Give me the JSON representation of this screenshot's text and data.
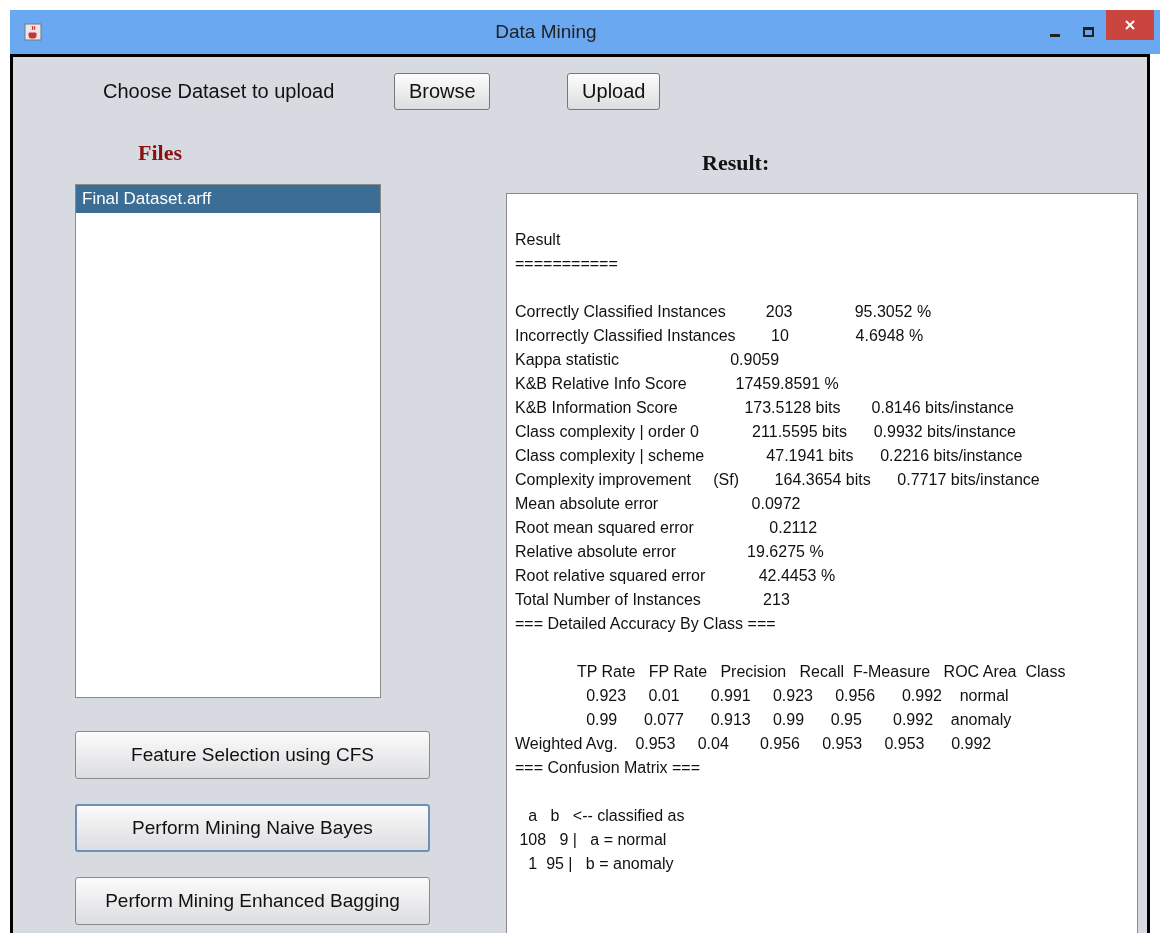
{
  "window": {
    "title": "Data Mining"
  },
  "upload_row": {
    "label": "Choose Dataset to upload",
    "buttons": [
      "Browse",
      "Upload"
    ]
  },
  "files": {
    "heading": "Files",
    "items": [
      {
        "label": "Final Dataset.arff",
        "selected": true
      }
    ]
  },
  "actions": [
    {
      "label": "Feature Selection using CFS",
      "focused": false
    },
    {
      "label": "Perform Mining Naive Bayes",
      "focused": true
    },
    {
      "label": "Perform Mining Enhanced Bagging",
      "focused": false
    }
  ],
  "result": {
    "heading": "Result:",
    "sections": [
      [
        "Result",
        "==========="
      ],
      [
        "Correctly Classified Instances         203              95.3052 %",
        "Incorrectly Classified Instances        10               4.6948 %",
        "Kappa statistic                         0.9059",
        "K&B Relative Info Score           17459.8591 %",
        "K&B Information Score               173.5128 bits       0.8146 bits/instance",
        "Class complexity | order 0            211.5595 bits      0.9932 bits/instance",
        "Class complexity | scheme              47.1941 bits      0.2216 bits/instance",
        "Complexity improvement     (Sf)        164.3654 bits      0.7717 bits/instance",
        "Mean absolute error                     0.0972",
        "Root mean squared error                 0.2112",
        "Relative absolute error                19.6275 %",
        "Root relative squared error            42.4453 %",
        "Total Number of Instances              213",
        "=== Detailed Accuracy By Class ==="
      ],
      [
        "              TP Rate   FP Rate   Precision   Recall  F-Measure   ROC Area  Class",
        "                0.923     0.01       0.991     0.923     0.956      0.992    normal",
        "                0.99      0.077      0.913     0.99      0.95       0.992    anomaly",
        "Weighted Avg.    0.953     0.04       0.956     0.953     0.953      0.992",
        "=== Confusion Matrix ==="
      ],
      [
        "   a   b   <-- classified as",
        " 108   9 |   a = normal",
        "   1  95 |   b = anomaly"
      ]
    ]
  }
}
